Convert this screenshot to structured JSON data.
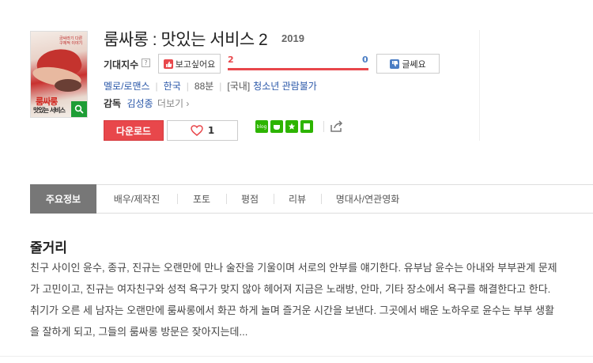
{
  "poster": {
    "tag_text": "금싸라기 다른 구체적 이야기",
    "title_text": "룸싸롱",
    "subtitle_text": "맛있는 서비스",
    "zoom_icon": "magnifier-icon"
  },
  "movie": {
    "title": "룸싸롱 : 맛있는 서비스 2",
    "year": "2019"
  },
  "expectation": {
    "label": "기대지수",
    "help": "?",
    "want_label": "보고싶어요",
    "want_count": "2",
    "meh_count": "0",
    "meh_label": "글쎄요",
    "want_ratio": 1.0
  },
  "meta": {
    "genre": "멜로/로맨스",
    "country": "한국",
    "runtime": "88분",
    "rating_prefix": "[국내]",
    "rating": "청소년 관람불가"
  },
  "director": {
    "label": "감독",
    "name": "김성종",
    "more": "더보기 ›"
  },
  "actions": {
    "download": "다운로드",
    "likes": "1"
  },
  "tabs": [
    {
      "label": "주요정보"
    },
    {
      "label": "배우/제작진"
    },
    {
      "label": "포토"
    },
    {
      "label": "평점"
    },
    {
      "label": "리뷰"
    },
    {
      "label": "명대사/연관영화"
    }
  ],
  "synopsis": {
    "heading": "줄거리",
    "text": "친구 사이인 윤수, 종규, 진규는 오랜만에 만나 술잔을 기울이며 서로의 안부를 얘기한다. 유부남 윤수는 아내와 부부관계 문제가 고민이고, 진규는 여자친구와 성적 욕구가 맞지 않아 헤어져 지금은 노래방, 안마, 기타 장소에서 욕구를 해결한다고 한다. 취기가 오른 세 남자는 오랜만에 룸싸롱에서 화끈 하게 놀며 즐거운 시간을 보낸다. 그곳에서 배운 노하우로 윤수는 부부 생활을 잘하게 되고, 그들의 룸싸롱 방문은 잦아지는데..."
  },
  "colors": {
    "accent_red": "#e8474b",
    "accent_blue": "#4a7dc4",
    "link_blue": "#2a57a8",
    "tab_active": "#777777"
  }
}
